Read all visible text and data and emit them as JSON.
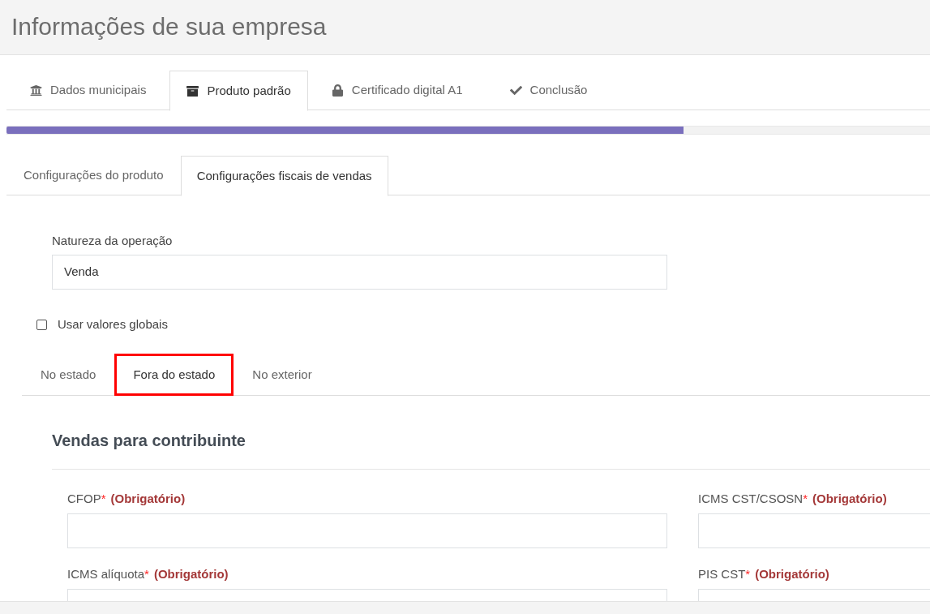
{
  "page": {
    "title": "Informações de sua empresa"
  },
  "wizard_tabs": [
    {
      "label": "Dados municipais",
      "selected": false
    },
    {
      "label": "Produto padrão",
      "selected": true
    },
    {
      "label": "Certificado digital A1",
      "selected": false
    },
    {
      "label": "Conclusão",
      "selected": false
    }
  ],
  "progress": {
    "level": 0.733
  },
  "section_tabs": [
    {
      "label": "Configurações do produto",
      "selected": false
    },
    {
      "label": "Configurações fiscais de vendas",
      "selected": true
    }
  ],
  "operation_nature": {
    "label": "Natureza da operação",
    "value": "Venda"
  },
  "global_values": {
    "label": "Usar valores globais",
    "checked": false
  },
  "region_tabs": [
    {
      "label": "No estado",
      "selected": false,
      "highlighted": false
    },
    {
      "label": "Fora do estado",
      "selected": true,
      "highlighted": true
    },
    {
      "label": "No exterior",
      "selected": false,
      "highlighted": false
    }
  ],
  "section": {
    "title": "Vendas para contribuinte",
    "fields": [
      {
        "label": "CFOP",
        "required_mark": "*",
        "note": "(Obrigatório)"
      },
      {
        "label": "ICMS CST/CSOSN",
        "required_mark": "*",
        "note": "(Obrigatório)"
      },
      {
        "label": "ICMS alíquota",
        "required_mark": "*",
        "note": "(Obrigatório)"
      },
      {
        "label": "PIS CST",
        "required_mark": "*",
        "note": "(Obrigatório)"
      }
    ]
  }
}
